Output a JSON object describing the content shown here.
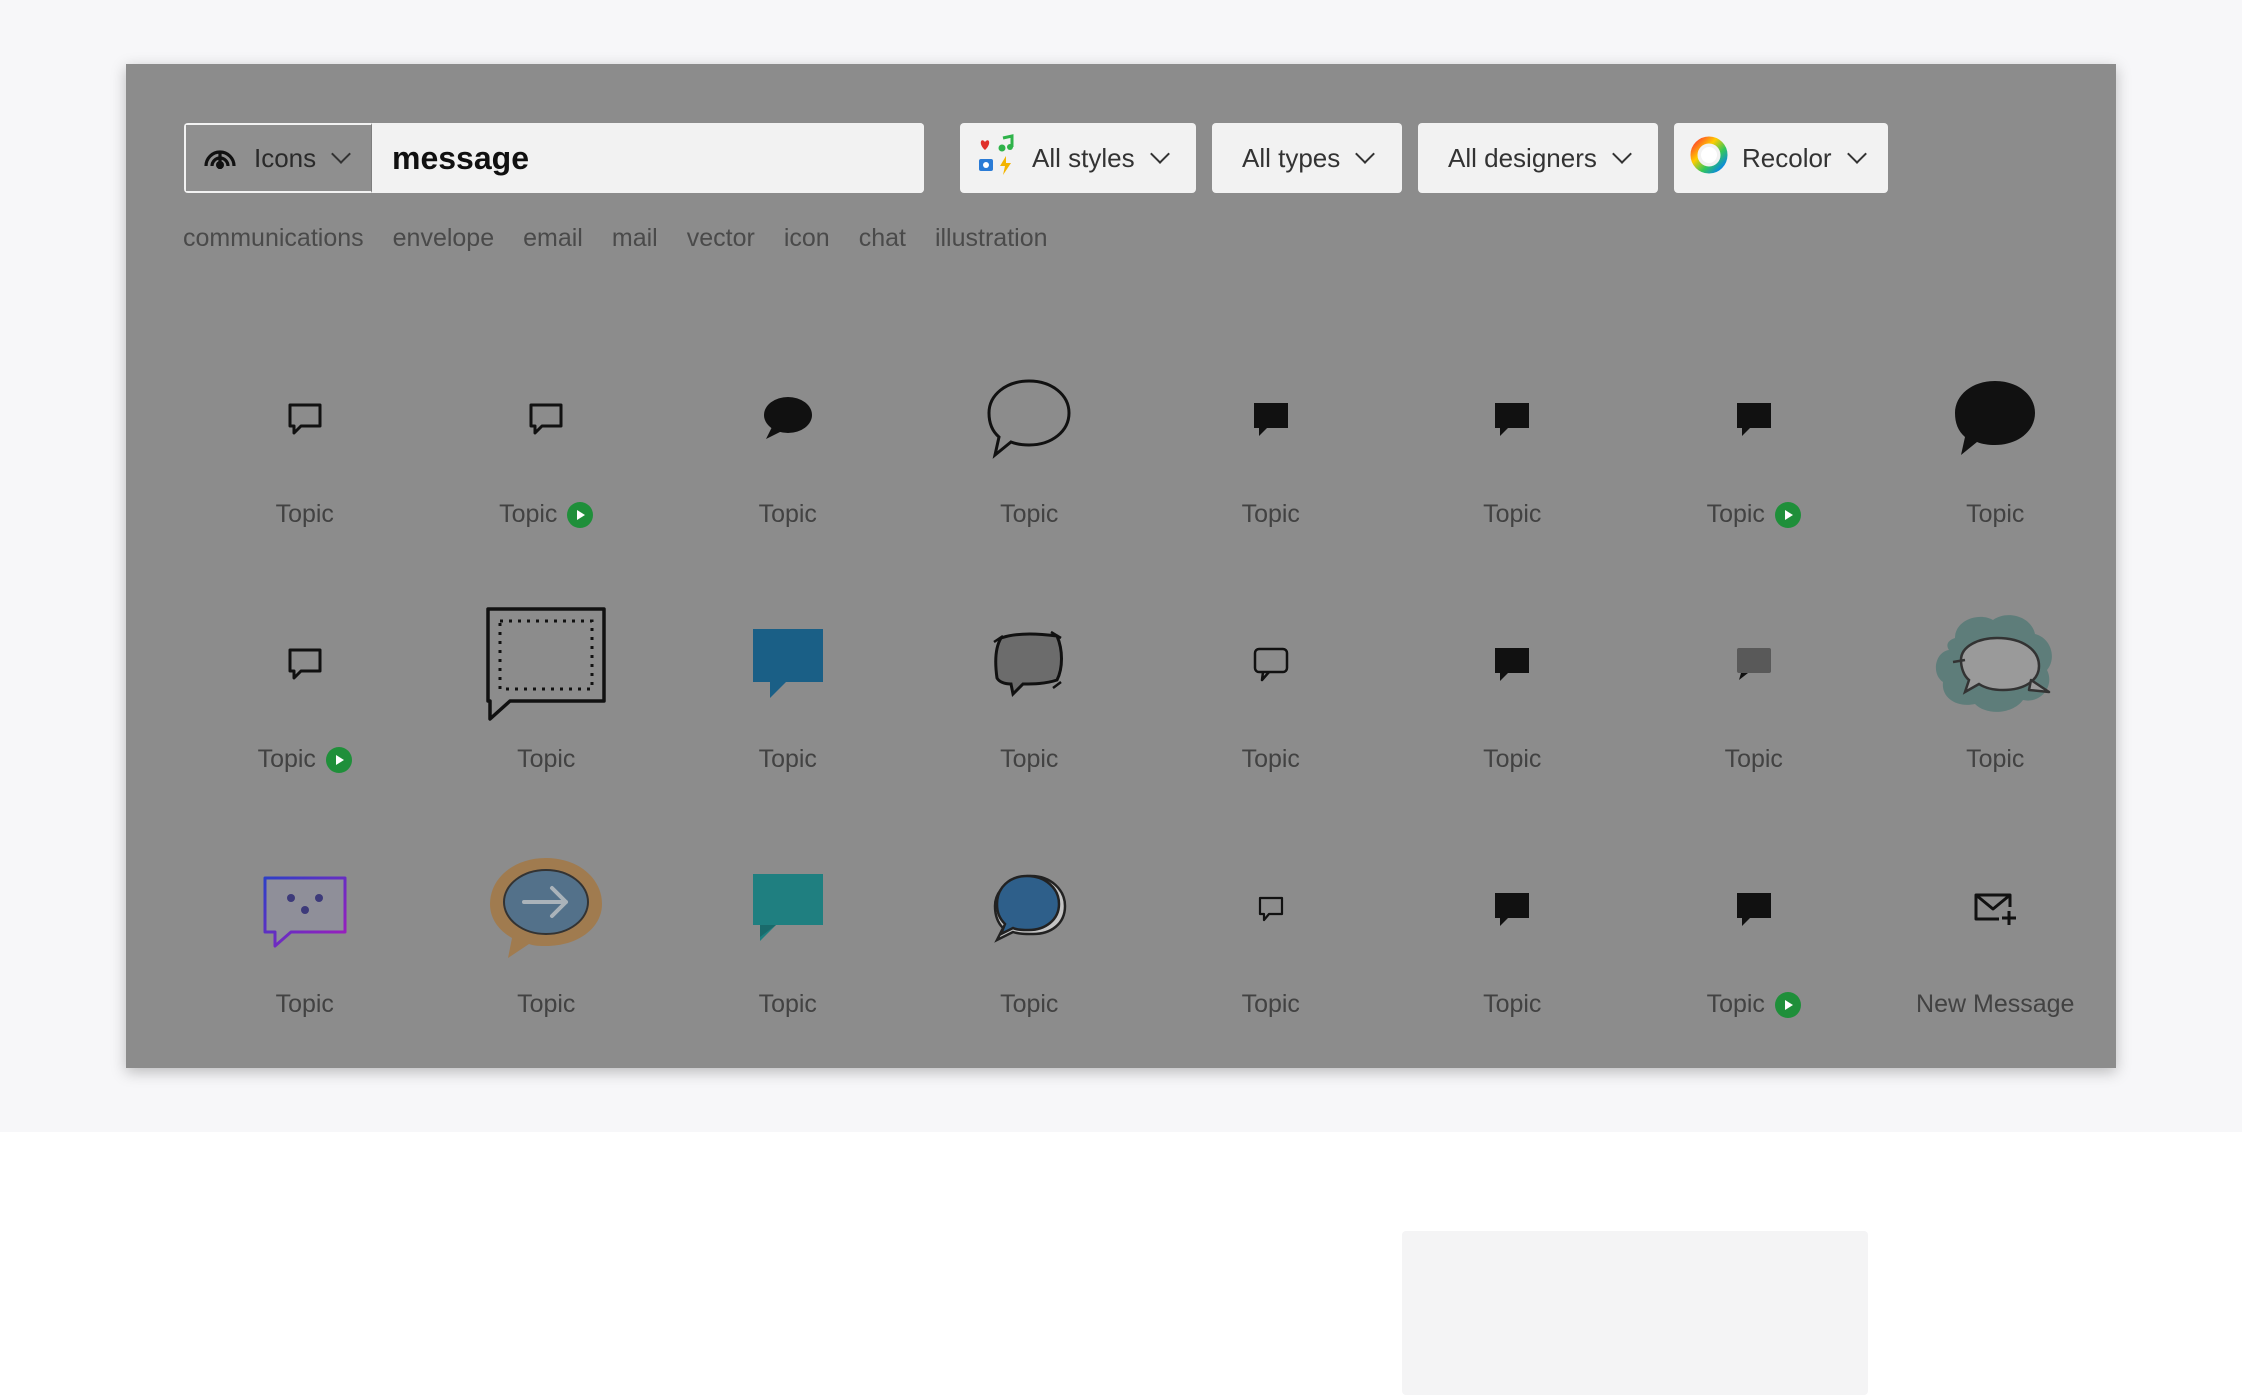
{
  "search": {
    "type_label": "Icons",
    "query": "message"
  },
  "filters": {
    "styles_label": "All styles",
    "types_label": "All types",
    "designers_label": "All designers",
    "recolor_label": "Recolor"
  },
  "related_tags": [
    "communications",
    "envelope",
    "email",
    "mail",
    "vector",
    "icon",
    "chat",
    "illustration"
  ],
  "results": [
    {
      "label": "Topic",
      "icon": "chat-outline-icon",
      "animated": false
    },
    {
      "label": "Topic",
      "icon": "chat-outline-icon",
      "animated": true
    },
    {
      "label": "Topic",
      "icon": "chat-round-filled-icon",
      "animated": false
    },
    {
      "label": "Topic",
      "icon": "speech-bubble-outline-icon",
      "animated": false
    },
    {
      "label": "Topic",
      "icon": "chat-filled-icon",
      "animated": false
    },
    {
      "label": "Topic",
      "icon": "chat-filled-icon",
      "animated": false
    },
    {
      "label": "Topic",
      "icon": "chat-filled-icon",
      "animated": true
    },
    {
      "label": "Topic",
      "icon": "speech-bubble-filled-icon",
      "animated": false
    },
    {
      "label": "Topic",
      "icon": "chat-outline-icon",
      "animated": true
    },
    {
      "label": "Topic",
      "icon": "dotted-chat-box-icon",
      "animated": false
    },
    {
      "label": "Topic",
      "icon": "blue-chat-icon",
      "animated": false
    },
    {
      "label": "Topic",
      "icon": "sketch-chat-icon",
      "animated": false
    },
    {
      "label": "Topic",
      "icon": "chat-rounded-outline-icon",
      "animated": false
    },
    {
      "label": "Topic",
      "icon": "chat-filled-icon",
      "animated": false
    },
    {
      "label": "Topic",
      "icon": "grey-chat-icon",
      "animated": false
    },
    {
      "label": "Topic",
      "icon": "cloud-chat-icon",
      "animated": false
    },
    {
      "label": "Topic",
      "icon": "smiley-chat-icon",
      "animated": false
    },
    {
      "label": "Topic",
      "icon": "arrow-bubble-icon",
      "animated": false
    },
    {
      "label": "Topic",
      "icon": "teal-chat-icon",
      "animated": false
    },
    {
      "label": "Topic",
      "icon": "blue-bubble-icon",
      "animated": false
    },
    {
      "label": "Topic",
      "icon": "chat-small-outline-icon",
      "animated": false
    },
    {
      "label": "Topic",
      "icon": "chat-filled-icon",
      "animated": false
    },
    {
      "label": "Topic",
      "icon": "chat-filled-icon",
      "animated": true
    },
    {
      "label": "New Message",
      "icon": "envelope-plus-icon",
      "animated": false
    }
  ],
  "colors": {
    "overlay": "#8c8c8c",
    "badge_green": "#1f8f3a"
  }
}
